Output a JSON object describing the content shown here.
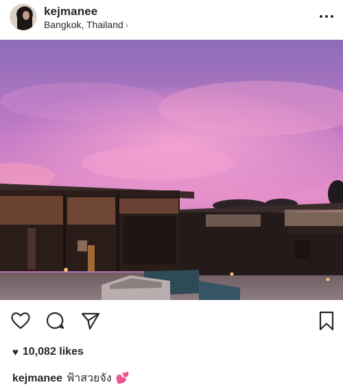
{
  "post": {
    "username": "kejmanee",
    "location": "Bangkok, Thailand",
    "location_chevron": "›",
    "likes_count": "10,082 likes",
    "caption_user": "kejmanee",
    "caption_text": "ฟ้าสวยจัง",
    "caption_emoji": "💕"
  },
  "icons": {
    "more": "more-options-icon",
    "like": "heart-icon",
    "comment": "comment-icon",
    "share": "send-icon",
    "save": "bookmark-icon",
    "likes_heart": "♥"
  },
  "colors": {
    "text": "#262626",
    "secondary": "#8e8e8e",
    "sky_top": "#8a6fb9",
    "sky_pink": "#e98dc9",
    "building": "#2a1d1a"
  }
}
